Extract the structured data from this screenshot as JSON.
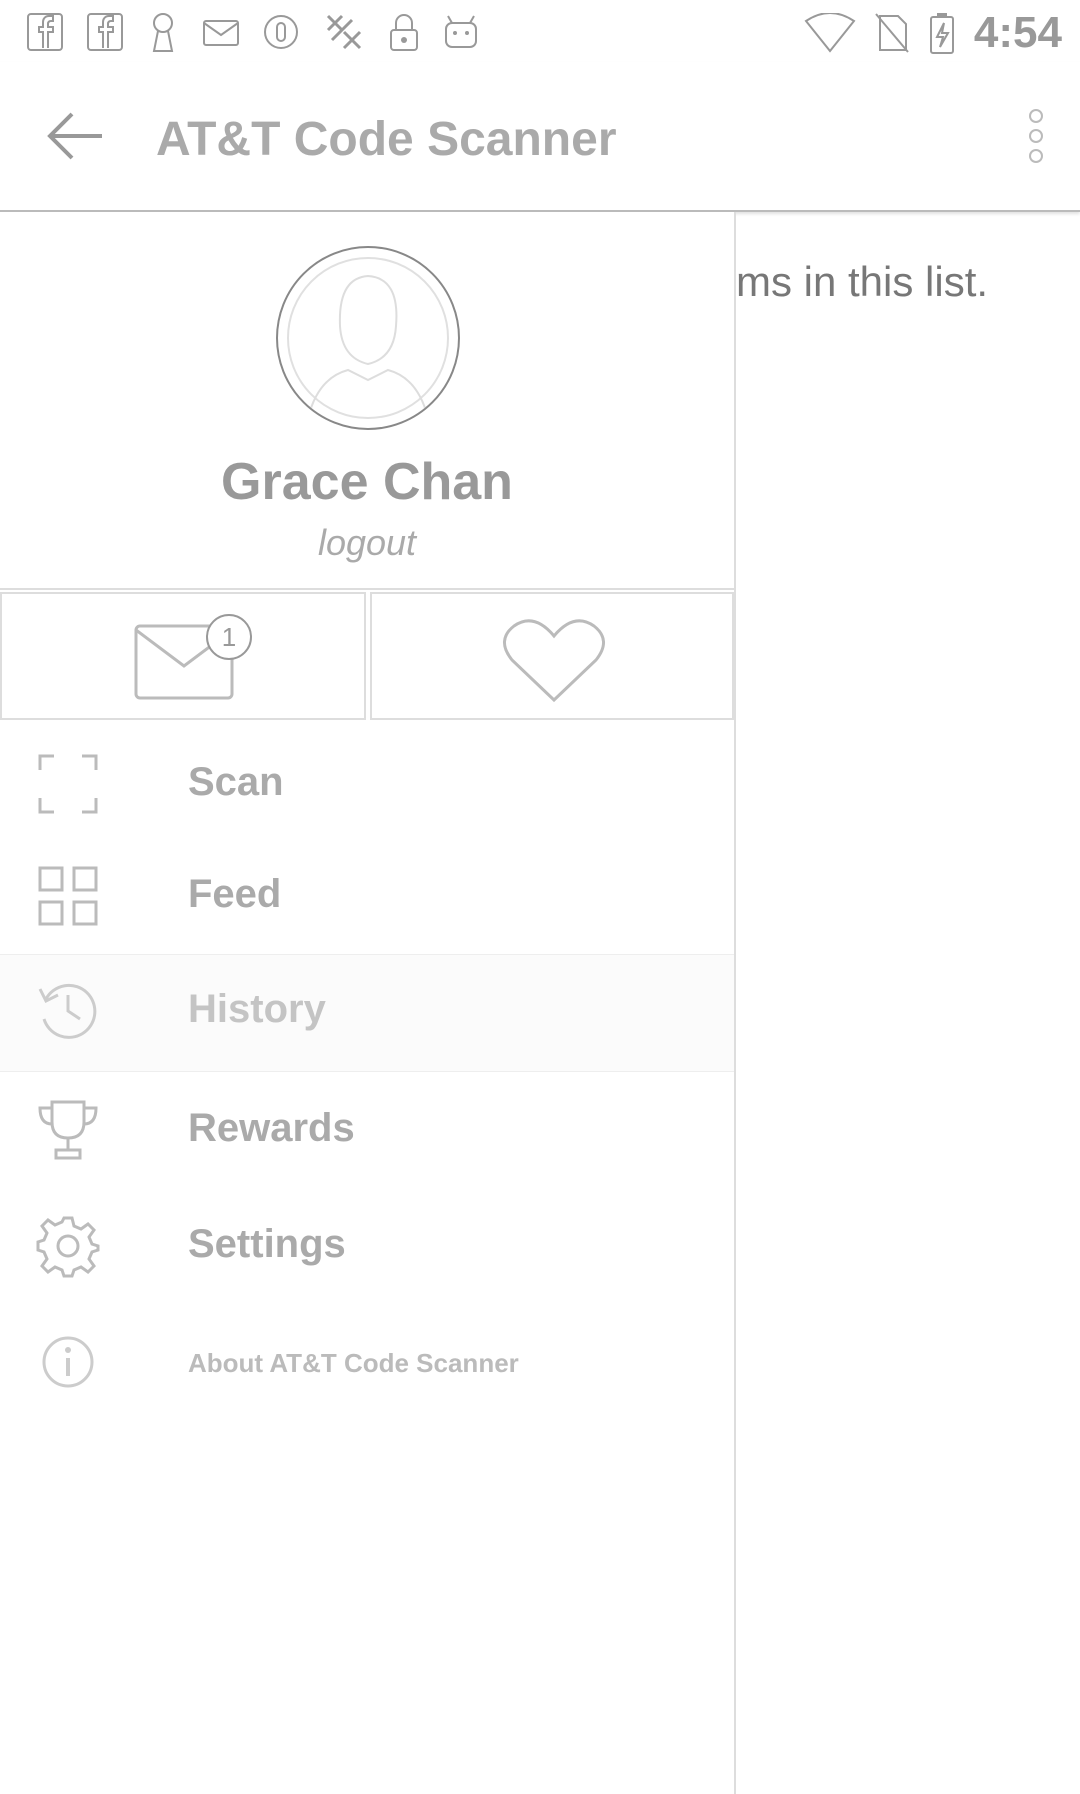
{
  "status_bar": {
    "time": "4:54",
    "left_icons": [
      "facebook-icon",
      "facebook-icon",
      "keyhole-icon",
      "mail-icon",
      "circle-icon",
      "puzzle-icon",
      "lock-icon",
      "android-icon"
    ],
    "right_icons": [
      "wifi-icon",
      "no-sim-icon",
      "battery-charging-icon"
    ]
  },
  "app_bar": {
    "title": "AT&T Code Scanner",
    "back_icon": "arrow-back-icon",
    "overflow_icon": "more-vertical-icon"
  },
  "background_content": {
    "partial_text": "ms in this list."
  },
  "drawer": {
    "profile": {
      "name": "Grace Chan",
      "logout_label": "logout",
      "avatar_icon": "avatar-icon"
    },
    "quick_actions": {
      "messages_badge": "1",
      "messages_icon": "envelope-icon",
      "favorites_icon": "heart-icon"
    },
    "menu": [
      {
        "label": "Scan",
        "icon": "scan-icon"
      },
      {
        "label": "Feed",
        "icon": "grid-icon"
      },
      {
        "label": "History",
        "icon": "history-icon"
      },
      {
        "label": "Rewards",
        "icon": "trophy-icon"
      },
      {
        "label": "Settings",
        "icon": "gear-icon"
      },
      {
        "label": "About AT&T Code Scanner",
        "icon": "info-icon"
      }
    ]
  },
  "colors": {
    "background": "#ffffff",
    "divider": "#dddddd",
    "text_muted": "#aaaaaa"
  }
}
